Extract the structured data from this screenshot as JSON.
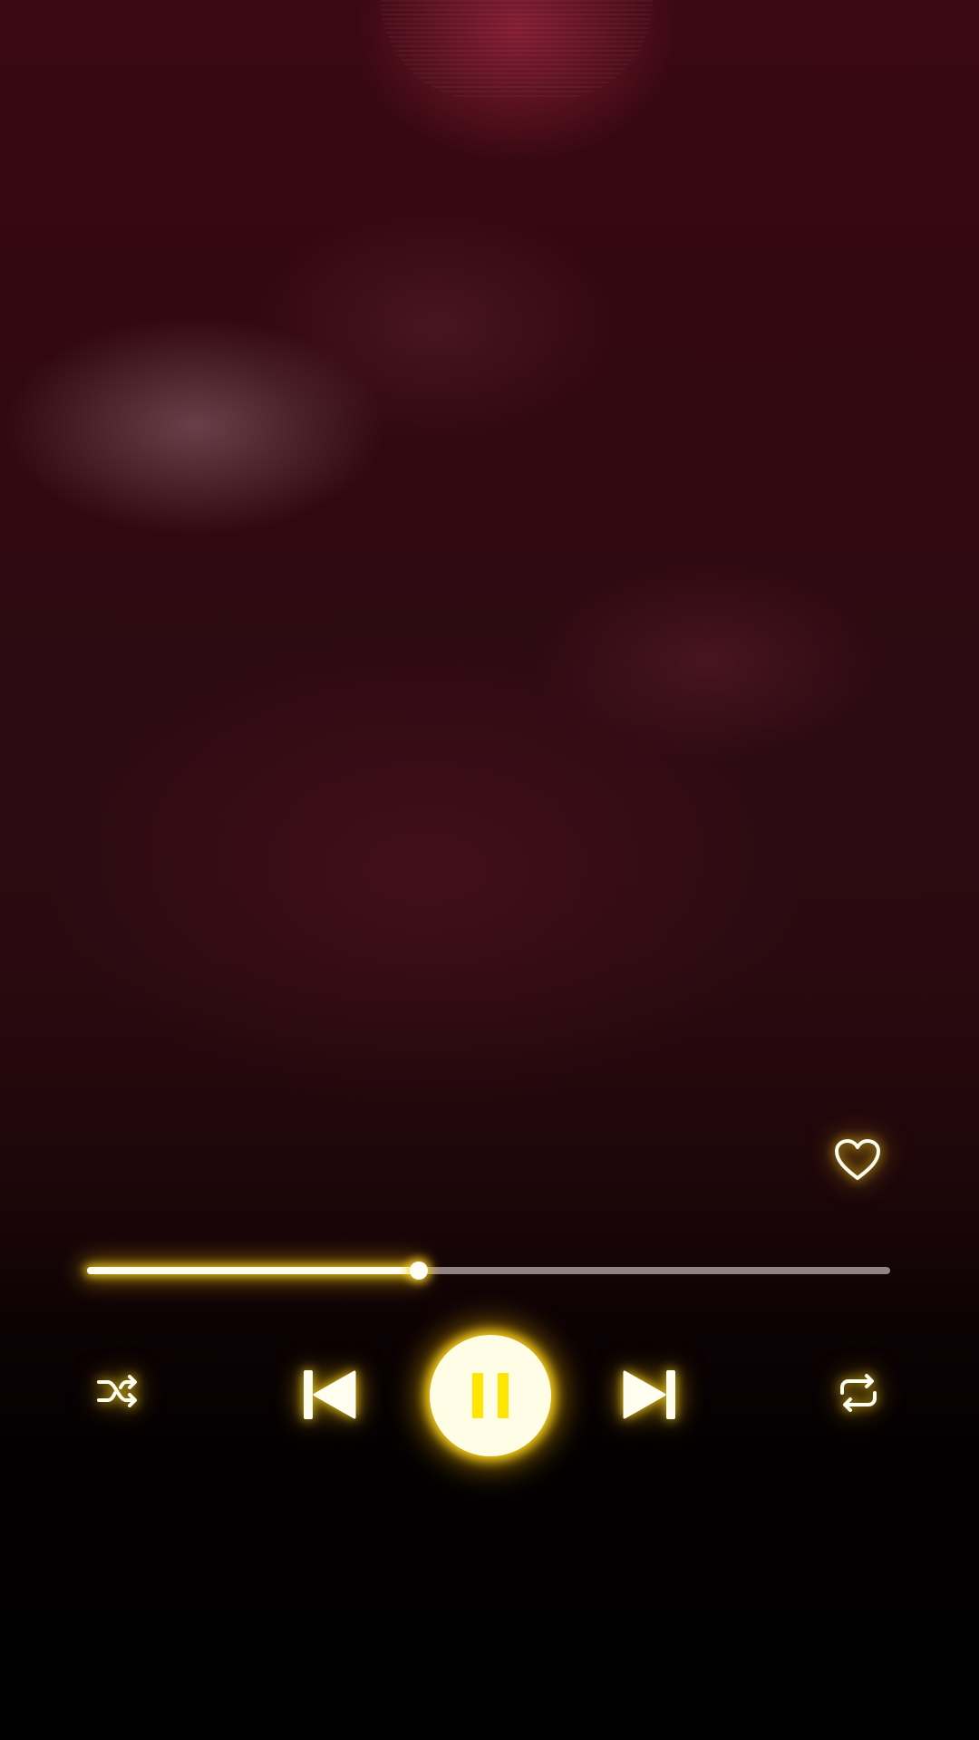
{
  "player": {
    "progress_fraction": 0.413,
    "accent_color": "#ffd21f",
    "glow_color": "#ffcc00",
    "track_color": "#8f8488",
    "state": "playing",
    "favorited": false
  },
  "icons": {
    "favorite": "heart-outline-icon",
    "shuffle": "shuffle-icon",
    "previous": "skip-previous-icon",
    "play_pause": "pause-icon",
    "next": "skip-next-icon",
    "repeat": "repeat-icon"
  }
}
